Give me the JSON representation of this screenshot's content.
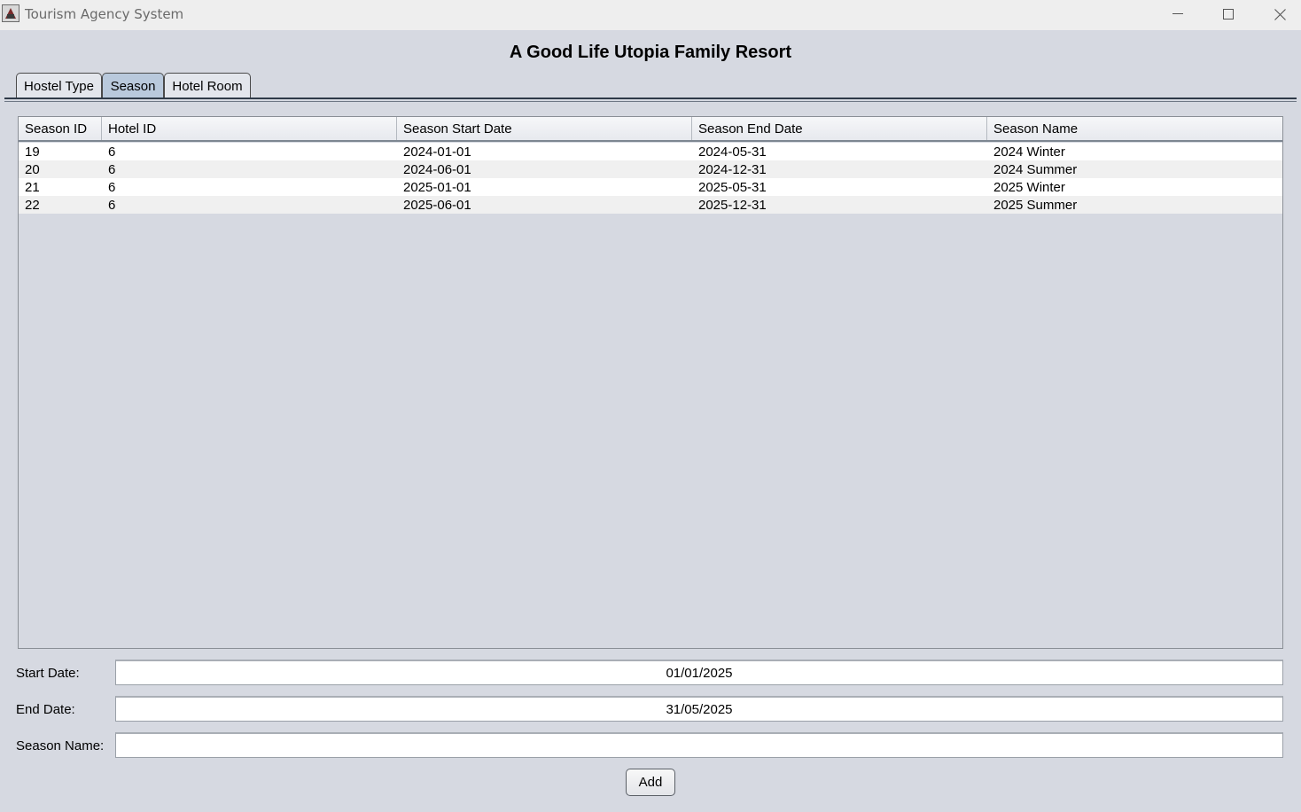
{
  "window": {
    "title": "Tourism Agency System",
    "icons": {
      "app": "java-cup-icon",
      "minimize": "minimize-icon",
      "maximize": "maximize-icon",
      "close": "close-icon"
    }
  },
  "header": {
    "title": "A Good Life Utopia Family Resort"
  },
  "tabs": [
    {
      "label": "Hostel Type",
      "active": false
    },
    {
      "label": "Season",
      "active": true
    },
    {
      "label": "Hotel Room",
      "active": false
    }
  ],
  "table": {
    "columns": [
      "Season ID",
      "Hotel ID",
      "Season Start Date",
      "Season End Date",
      "Season Name"
    ],
    "rows": [
      [
        "19",
        "6",
        "2024-01-01",
        "2024-05-31",
        "2024 Winter"
      ],
      [
        "20",
        "6",
        "2024-06-01",
        "2024-12-31",
        "2024 Summer"
      ],
      [
        "21",
        "6",
        "2025-01-01",
        "2025-05-31",
        "2025 Winter"
      ],
      [
        "22",
        "6",
        "2025-06-01",
        "2025-12-31",
        "2025 Summer"
      ]
    ]
  },
  "form": {
    "start_date_label": "Start Date:",
    "start_date_value": "01/01/2025",
    "end_date_label": "End Date:",
    "end_date_value": "31/05/2025",
    "season_name_label": "Season Name:",
    "season_name_value": "",
    "add_label": "Add"
  },
  "colors": {
    "background": "#d6d9e1",
    "active_tab": "#b9c9dc",
    "titlebar": "#eeeeee"
  }
}
